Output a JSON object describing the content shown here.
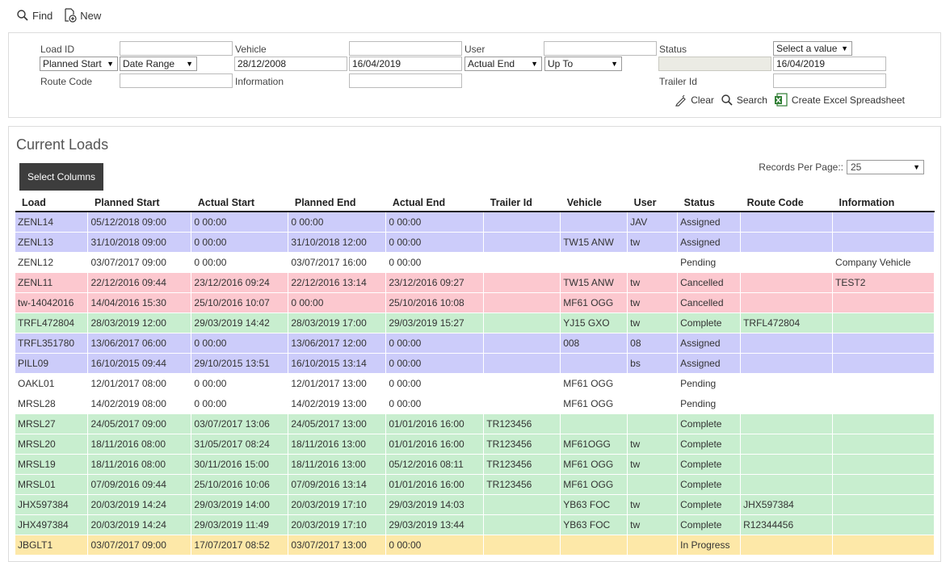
{
  "toolbar": {
    "find_label": "Find",
    "new_label": "New"
  },
  "filters": {
    "load_id_label": "Load ID",
    "load_id_value": "",
    "vehicle_label": "Vehicle",
    "vehicle_value": "",
    "user_label": "User",
    "user_value": "",
    "status_label": "Status",
    "status_select": "Select a value",
    "date_type_select": "Planned Start",
    "date_range_select": "Date Range",
    "date_from": "28/12/2008",
    "date_to": "16/04/2019",
    "end_type_select": "Actual End",
    "end_range_select": "Up To",
    "end_from": "",
    "end_to": "16/04/2019",
    "route_code_label": "Route Code",
    "route_code_value": "",
    "information_label": "Information",
    "information_value": "",
    "trailer_id_label": "Trailer Id",
    "trailer_id_value": "",
    "clear_label": "Clear",
    "search_label": "Search",
    "excel_label": "Create Excel Spreadsheet"
  },
  "results": {
    "title": "Current Loads",
    "select_columns_label": "Select Columns",
    "records_per_page_label": "Records Per Page::",
    "records_per_page_value": "25",
    "columns": [
      "Load",
      "Planned Start",
      "Actual Start",
      "Planned End",
      "Actual End",
      "Trailer Id",
      "Vehicle",
      "User",
      "Status",
      "Route Code",
      "Information"
    ],
    "rows": [
      {
        "load": "ZENL14",
        "planned_start": "05/12/2018 09:00",
        "actual_start": "0 00:00",
        "planned_end": "0 00:00",
        "actual_end": "0 00:00",
        "trailer_id": "",
        "vehicle": "",
        "user": "JAV",
        "status": "Assigned",
        "route_code": "",
        "information": ""
      },
      {
        "load": "ZENL13",
        "planned_start": "31/10/2018 09:00",
        "actual_start": "0 00:00",
        "planned_end": "31/10/2018 12:00",
        "actual_end": "0 00:00",
        "trailer_id": "",
        "vehicle": "TW15 ANW",
        "user": "tw",
        "status": "Assigned",
        "route_code": "",
        "information": ""
      },
      {
        "load": "ZENL12",
        "planned_start": "03/07/2017 09:00",
        "actual_start": "0 00:00",
        "planned_end": "03/07/2017 16:00",
        "actual_end": "0 00:00",
        "trailer_id": "",
        "vehicle": "",
        "user": "",
        "status": "Pending",
        "route_code": "",
        "information": "Company Vehicle"
      },
      {
        "load": "ZENL11",
        "planned_start": "22/12/2016 09:44",
        "actual_start": "23/12/2016 09:24",
        "planned_end": "22/12/2016 13:14",
        "actual_end": "23/12/2016 09:27",
        "trailer_id": "",
        "vehicle": "TW15 ANW",
        "user": "tw",
        "status": "Cancelled",
        "route_code": "",
        "information": "TEST2"
      },
      {
        "load": "tw-14042016",
        "planned_start": "14/04/2016 15:30",
        "actual_start": "25/10/2016 10:07",
        "planned_end": "0 00:00",
        "actual_end": "25/10/2016 10:08",
        "trailer_id": "",
        "vehicle": "MF61 OGG",
        "user": "tw",
        "status": "Cancelled",
        "route_code": "",
        "information": ""
      },
      {
        "load": "TRFL472804",
        "planned_start": "28/03/2019 12:00",
        "actual_start": "29/03/2019 14:42",
        "planned_end": "28/03/2019 17:00",
        "actual_end": "29/03/2019 15:27",
        "trailer_id": "",
        "vehicle": "YJ15 GXO",
        "user": "tw",
        "status": "Complete",
        "route_code": "TRFL472804",
        "information": ""
      },
      {
        "load": "TRFL351780",
        "planned_start": "13/06/2017 06:00",
        "actual_start": "0 00:00",
        "planned_end": "13/06/2017 12:00",
        "actual_end": "0 00:00",
        "trailer_id": "",
        "vehicle": "008",
        "user": "08",
        "status": "Assigned",
        "route_code": "",
        "information": ""
      },
      {
        "load": "PILL09",
        "planned_start": "16/10/2015 09:44",
        "actual_start": "29/10/2015 13:51",
        "planned_end": "16/10/2015 13:14",
        "actual_end": "0 00:00",
        "trailer_id": "",
        "vehicle": "",
        "user": "bs",
        "status": "Assigned",
        "route_code": "",
        "information": ""
      },
      {
        "load": "OAKL01",
        "planned_start": "12/01/2017 08:00",
        "actual_start": "0 00:00",
        "planned_end": "12/01/2017 13:00",
        "actual_end": "0 00:00",
        "trailer_id": "",
        "vehicle": "MF61 OGG",
        "user": "",
        "status": "Pending",
        "route_code": "",
        "information": ""
      },
      {
        "load": "MRSL28",
        "planned_start": "14/02/2019 08:00",
        "actual_start": "0 00:00",
        "planned_end": "14/02/2019 13:00",
        "actual_end": "0 00:00",
        "trailer_id": "",
        "vehicle": "MF61 OGG",
        "user": "",
        "status": "Pending",
        "route_code": "",
        "information": ""
      },
      {
        "load": "MRSL27",
        "planned_start": "24/05/2017 09:00",
        "actual_start": "03/07/2017 13:06",
        "planned_end": "24/05/2017 13:00",
        "actual_end": "01/01/2016 16:00",
        "trailer_id": "TR123456",
        "vehicle": "",
        "user": "",
        "status": "Complete",
        "route_code": "",
        "information": ""
      },
      {
        "load": "MRSL20",
        "planned_start": "18/11/2016 08:00",
        "actual_start": "31/05/2017 08:24",
        "planned_end": "18/11/2016 13:00",
        "actual_end": "01/01/2016 16:00",
        "trailer_id": "TR123456",
        "vehicle": "MF61OGG",
        "user": "tw",
        "status": "Complete",
        "route_code": "",
        "information": ""
      },
      {
        "load": "MRSL19",
        "planned_start": "18/11/2016 08:00",
        "actual_start": "30/11/2016 15:00",
        "planned_end": "18/11/2016 13:00",
        "actual_end": "05/12/2016 08:11",
        "trailer_id": "TR123456",
        "vehicle": "MF61 OGG",
        "user": "tw",
        "status": "Complete",
        "route_code": "",
        "information": ""
      },
      {
        "load": "MRSL01",
        "planned_start": "07/09/2016 09:44",
        "actual_start": "25/10/2016 10:06",
        "planned_end": "07/09/2016 13:14",
        "actual_end": "01/01/2016 16:00",
        "trailer_id": "TR123456",
        "vehicle": "MF61 OGG",
        "user": "",
        "status": "Complete",
        "route_code": "",
        "information": ""
      },
      {
        "load": "JHX597384",
        "planned_start": "20/03/2019 14:24",
        "actual_start": "29/03/2019 14:00",
        "planned_end": "20/03/2019 17:10",
        "actual_end": "29/03/2019 14:03",
        "trailer_id": "",
        "vehicle": "YB63 FOC",
        "user": "tw",
        "status": "Complete",
        "route_code": "JHX597384",
        "information": ""
      },
      {
        "load": "JHX497384",
        "planned_start": "20/03/2019 14:24",
        "actual_start": "29/03/2019 11:49",
        "planned_end": "20/03/2019 17:10",
        "actual_end": "29/03/2019 13:44",
        "trailer_id": "",
        "vehicle": "YB63 FOC",
        "user": "tw",
        "status": "Complete",
        "route_code": "R12344456",
        "information": ""
      },
      {
        "load": "JBGLT1",
        "planned_start": "03/07/2017 09:00",
        "actual_start": "17/07/2017 08:52",
        "planned_end": "03/07/2017 13:00",
        "actual_end": "0 00:00",
        "trailer_id": "",
        "vehicle": "",
        "user": "",
        "status": "In Progress",
        "route_code": "",
        "information": ""
      }
    ]
  },
  "status_colors": {
    "Assigned": "#ccccfa",
    "Pending": "#ffffff",
    "Cancelled": "#fcc8cf",
    "Complete": "#c8eecf",
    "In Progress": "#fde8a8"
  }
}
